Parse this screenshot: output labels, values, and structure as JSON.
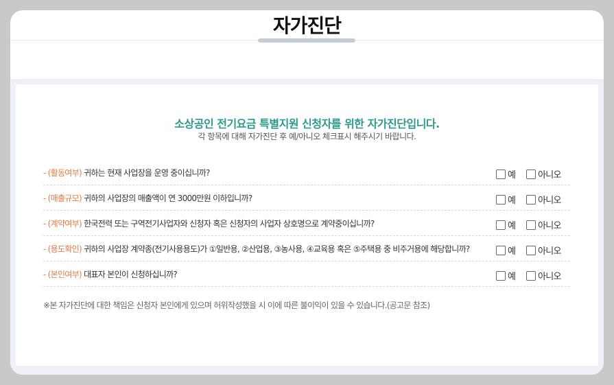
{
  "page": {
    "title": "자가진단"
  },
  "intro": {
    "headline": "소상공인 전기요금 특별지원 신청자를 위한 자가진단입니다.",
    "subline": "각 항목에 대해 자가진단 후 예/아니오 체크표시 해주시기 바랍니다."
  },
  "options": {
    "yes": "예",
    "no": "아니오"
  },
  "questions": [
    {
      "tag": "(활동여부)",
      "text": "귀하는 현재 사업장을 운영 중이십니까?"
    },
    {
      "tag": "(매출규모)",
      "text": "귀하의 사업장의 매출액이 연 3000만원 이하입니까?"
    },
    {
      "tag": "(계약여부)",
      "text": "한국전력 또는 구역전기사업자와 신청자 혹은 신청자의 사업자 상호명으로 계약중이십니까?"
    },
    {
      "tag": "(용도확인)",
      "text": "귀하의 사업장 계약종(전기사용용도)가 ①일반용, ②산업용, ③농사용, ④교육용 혹은 ⑤주택용 중 비주거용에 해당합니까?"
    },
    {
      "tag": "(본인여부)",
      "text": "대표자 본인이 신청하십니까?"
    }
  ],
  "footer_note": "※본 자가진단에 대한 책임은 신청자 본인에게 있으며 허위작성했을 시 이에 따른 불이익이 있을 수 있습니다.(공고문 참조)"
}
